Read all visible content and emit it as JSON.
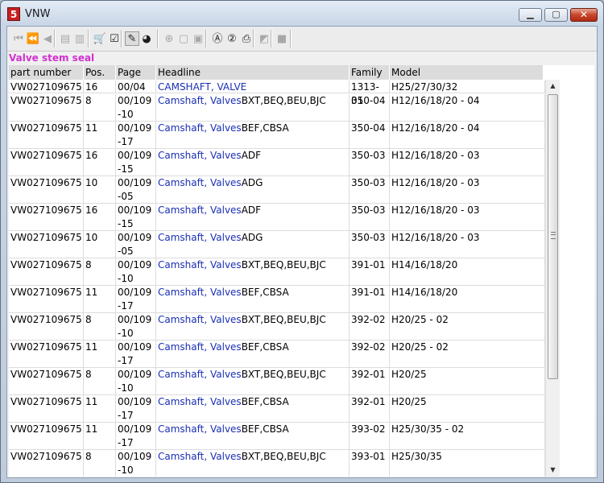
{
  "window": {
    "title": "VNW",
    "app_icon_glyph": "5",
    "controls": {
      "minimize": "▁",
      "maximize": "▢",
      "close": "✕"
    }
  },
  "toolbar": {
    "buttons": [
      {
        "name": "first-record-icon",
        "glyph": "⏮",
        "enabled": false
      },
      {
        "name": "previous-page-icon",
        "glyph": "⏪",
        "enabled": false
      },
      {
        "name": "previous-record-icon",
        "glyph": "◀",
        "enabled": false
      },
      {
        "name": "back-document-icon",
        "glyph": "▤",
        "enabled": false
      },
      {
        "name": "forward-document-icon",
        "glyph": "▥",
        "enabled": false
      },
      {
        "name": "cart-icon",
        "glyph": "🛒",
        "enabled": true
      },
      {
        "name": "checklist-icon",
        "glyph": "☑",
        "enabled": true
      },
      {
        "name": "pen-tool-icon",
        "glyph": "✎",
        "enabled": true,
        "pressed": true
      },
      {
        "name": "globe-icon",
        "glyph": "◕",
        "enabled": true
      },
      {
        "name": "zoom-icon",
        "glyph": "⊕",
        "enabled": false
      },
      {
        "name": "page-icon",
        "glyph": "▢",
        "enabled": false
      },
      {
        "name": "page-alt-icon",
        "glyph": "▣",
        "enabled": false
      },
      {
        "name": "circle-a-icon",
        "glyph": "Ⓐ",
        "enabled": true
      },
      {
        "name": "circle-2-icon",
        "glyph": "②",
        "enabled": true
      },
      {
        "name": "print-icon",
        "glyph": "⎙",
        "enabled": true
      },
      {
        "name": "eraser-icon",
        "glyph": "◩",
        "enabled": false
      },
      {
        "name": "stop-icon",
        "glyph": "■",
        "enabled": false
      }
    ]
  },
  "section_title": "Valve stem seal",
  "table": {
    "columns": [
      "part number",
      "Pos.",
      "Page",
      "Headline",
      "Family",
      "Model"
    ],
    "rows": [
      {
        "part": "VW027109675",
        "pos": "16",
        "page": "00/04",
        "link": "CAMSHAFT, VALVE",
        "rest": "",
        "family": "1313-01",
        "model": "H25/27/30/32"
      },
      {
        "part": "VW027109675",
        "pos": "8",
        "page": "00/109-10",
        "link": "Camshaft, Valves",
        "rest": "BXT,BEQ,BEU,BJC",
        "family": "350-04",
        "model": "H12/16/18/20 - 04"
      },
      {
        "part": "VW027109675",
        "pos": "11",
        "page": "00/109-17",
        "link": "Camshaft, Valves",
        "rest": "BEF,CBSA",
        "family": "350-04",
        "model": "H12/16/18/20 - 04"
      },
      {
        "part": "VW027109675",
        "pos": "16",
        "page": "00/109-15",
        "link": "Camshaft, Valves",
        "rest": "ADF",
        "family": "350-03",
        "model": "H12/16/18/20 - 03"
      },
      {
        "part": "VW027109675",
        "pos": "10",
        "page": "00/109-05",
        "link": "Camshaft, Valves",
        "rest": "ADG",
        "family": "350-03",
        "model": "H12/16/18/20 - 03"
      },
      {
        "part": "VW027109675",
        "pos": "16",
        "page": "00/109-15",
        "link": "Camshaft, Valves",
        "rest": "ADF",
        "family": "350-03",
        "model": "H12/16/18/20 - 03"
      },
      {
        "part": "VW027109675",
        "pos": "10",
        "page": "00/109-05",
        "link": "Camshaft, Valves",
        "rest": "ADG",
        "family": "350-03",
        "model": "H12/16/18/20 - 03"
      },
      {
        "part": "VW027109675",
        "pos": "8",
        "page": "00/109-10",
        "link": "Camshaft, Valves",
        "rest": "BXT,BEQ,BEU,BJC",
        "family": "391-01",
        "model": "H14/16/18/20"
      },
      {
        "part": "VW027109675",
        "pos": "11",
        "page": "00/109-17",
        "link": "Camshaft, Valves",
        "rest": "BEF,CBSA",
        "family": "391-01",
        "model": "H14/16/18/20"
      },
      {
        "part": "VW027109675",
        "pos": "8",
        "page": "00/109-10",
        "link": "Camshaft, Valves",
        "rest": "BXT,BEQ,BEU,BJC",
        "family": "392-02",
        "model": "H20/25 - 02"
      },
      {
        "part": "VW027109675",
        "pos": "11",
        "page": "00/109-17",
        "link": "Camshaft, Valves",
        "rest": "BEF,CBSA",
        "family": "392-02",
        "model": "H20/25 - 02"
      },
      {
        "part": "VW027109675",
        "pos": "8",
        "page": "00/109-10",
        "link": "Camshaft, Valves",
        "rest": "BXT,BEQ,BEU,BJC",
        "family": "392-01",
        "model": "H20/25"
      },
      {
        "part": "VW027109675",
        "pos": "11",
        "page": "00/109-17",
        "link": "Camshaft, Valves",
        "rest": "BEF,CBSA",
        "family": "392-01",
        "model": "H20/25"
      },
      {
        "part": "VW027109675",
        "pos": "11",
        "page": "00/109-17",
        "link": "Camshaft, Valves",
        "rest": "BEF,CBSA",
        "family": "393-02",
        "model": "H25/30/35 - 02"
      },
      {
        "part": "VW027109675",
        "pos": "8",
        "page": "00/109-10",
        "link": "Camshaft, Valves",
        "rest": "BXT,BEQ,BEU,BJC",
        "family": "393-01",
        "model": "H25/30/35"
      }
    ]
  },
  "scrollbar": {
    "up": "▲",
    "down": "▼"
  },
  "colors": {
    "section_title": "#d22fd0",
    "link": "#1a2fb4"
  }
}
